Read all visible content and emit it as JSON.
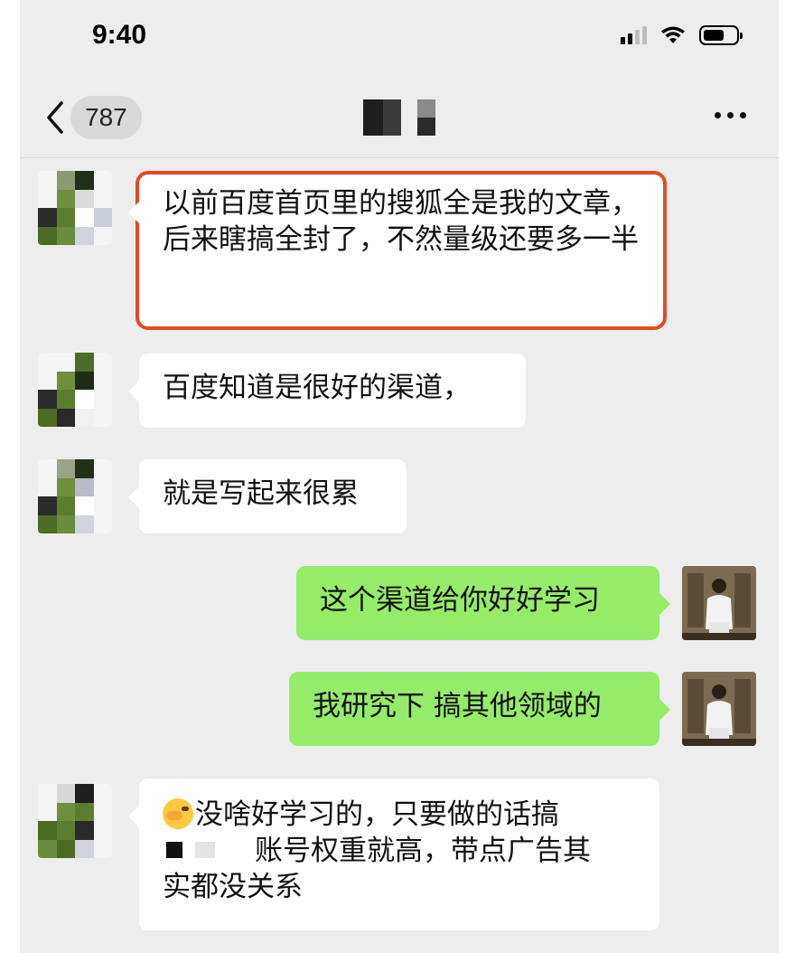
{
  "status_bar": {
    "time": "9:40"
  },
  "nav": {
    "back_count": "787",
    "title": "",
    "more_icon": "more-dots-icon"
  },
  "colors": {
    "chat_background": "#ededed",
    "incoming_bubble": "#ffffff",
    "outgoing_bubble": "#95ec69",
    "highlight_border": "#e34a24"
  },
  "messages": [
    {
      "side": "left",
      "text": "以前百度首页里的搜狐全是我的文章，后来瞎搞全封了，不然量级还要多一半",
      "highlighted": true
    },
    {
      "side": "left",
      "text": "百度知道是很好的渠道，"
    },
    {
      "side": "left",
      "text": "就是写起来很累"
    },
    {
      "side": "right",
      "text": "这个渠道给你好好学习"
    },
    {
      "side": "right",
      "text": "我研究下 搞其他领域的"
    },
    {
      "side": "left",
      "emoji": "facepalm-emoji",
      "text_line1": "没啥好学习的，只要做的话搞",
      "text_line2": "账号权重就高，带点广告其",
      "text_line3": "实都没关系"
    }
  ]
}
